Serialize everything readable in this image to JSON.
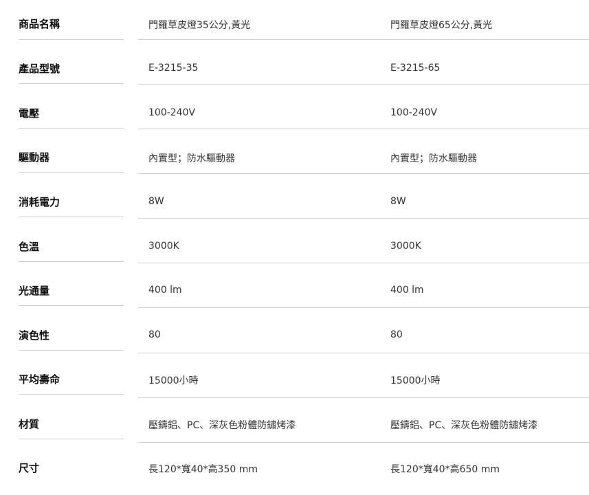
{
  "specs": {
    "rows": [
      {
        "label": "商品名稱",
        "values": [
          "門羅草皮燈35公分,黃光",
          "門羅草皮燈65公分,黃光"
        ]
      },
      {
        "label": "產品型號",
        "values": [
          "E-3215-35",
          "E-3215-65"
        ]
      },
      {
        "label": "電壓",
        "values": [
          "100-240V",
          "100-240V"
        ]
      },
      {
        "label": "驅動器",
        "values": [
          "內置型；防水驅動器",
          "內置型；防水驅動器"
        ]
      },
      {
        "label": "消耗電力",
        "values": [
          "8W",
          "8W"
        ]
      },
      {
        "label": "色溫",
        "values": [
          "3000K",
          "3000K"
        ]
      },
      {
        "label": "光通量",
        "values": [
          "400 lm",
          "400 lm"
        ]
      },
      {
        "label": "演色性",
        "values": [
          "80",
          "80"
        ]
      },
      {
        "label": "平均壽命",
        "values": [
          "15000小時",
          "15000小時"
        ]
      },
      {
        "label": "材質",
        "values": [
          "壓鑄鋁、PC、深灰色粉體防鏽烤漆",
          "壓鑄鋁、PC、深灰色粉體防鏽烤漆"
        ]
      },
      {
        "label": "尺寸",
        "values": [
          "長120*寬40*高350 mm",
          "長120*寬40*高650 mm"
        ]
      }
    ]
  }
}
